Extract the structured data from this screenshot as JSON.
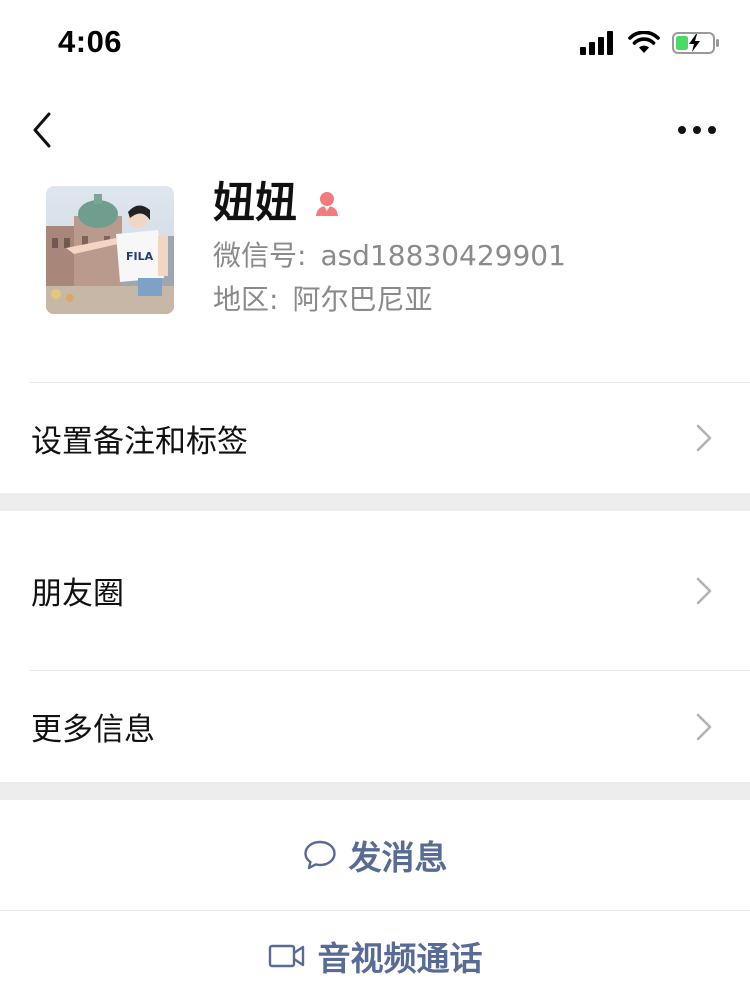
{
  "status_bar": {
    "time": "4:06",
    "icons": [
      "cellular-signal-icon",
      "wifi-icon",
      "battery-charging-icon"
    ]
  },
  "nav": {
    "back_icon": "chevron-left-icon",
    "more_icon": "more-dots-icon"
  },
  "profile": {
    "name": "妞妞",
    "gender_icon": "female-icon",
    "wechat_id_label": "微信号:",
    "wechat_id": "asd18830429901",
    "region_label": "地区:",
    "region": "阿尔巴尼亚"
  },
  "cells": {
    "remark": "设置备注和标签",
    "moments": "朋友圈",
    "more_info": "更多信息"
  },
  "actions": {
    "message": "发消息",
    "video_call": "音视频通话"
  },
  "colors": {
    "link_blue": "#576b95",
    "gender_female": "#f37b7d",
    "band_gray": "#ededed",
    "battery_green": "#4cd964"
  }
}
